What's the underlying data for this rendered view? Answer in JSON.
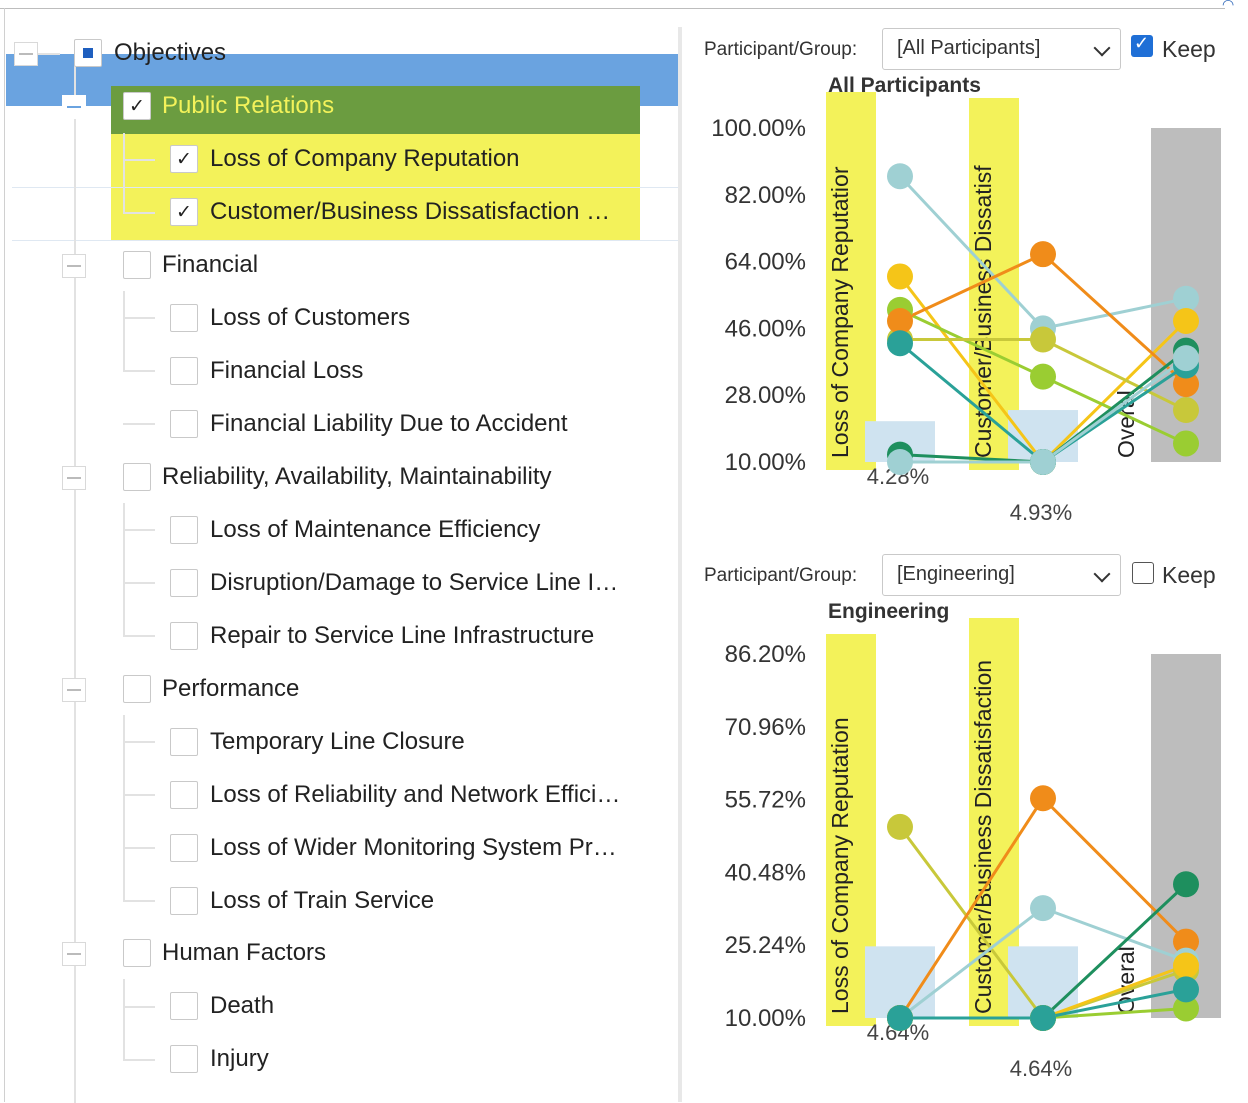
{
  "tree": {
    "root": {
      "label": "Objectives",
      "state": "partial"
    },
    "groups": [
      {
        "label": "Public Relations",
        "checked": true,
        "selected": true,
        "children": [
          {
            "label": "Loss of Company Reputation",
            "checked": true
          },
          {
            "label": "Customer/Business Dissatisfaction …",
            "checked": true
          }
        ]
      },
      {
        "label": "Financial",
        "checked": false,
        "children": [
          {
            "label": "Loss of Customers",
            "checked": false
          },
          {
            "label": "Financial Loss",
            "checked": false
          },
          {
            "label": "Financial Liability Due to Accident",
            "checked": false
          }
        ]
      },
      {
        "label": "Reliability, Availability, Maintainability",
        "checked": false,
        "children": [
          {
            "label": "Loss of Maintenance Efficiency",
            "checked": false
          },
          {
            "label": "Disruption/Damage to Service Line I…",
            "checked": false
          },
          {
            "label": "Repair to Service Line Infrastructure",
            "checked": false
          }
        ]
      },
      {
        "label": "Performance",
        "checked": false,
        "children": [
          {
            "label": "Temporary Line Closure",
            "checked": false
          },
          {
            "label": "Loss of Reliability and Network Effici…",
            "checked": false
          },
          {
            "label": "Loss of Wider Monitoring System Pr…",
            "checked": false
          },
          {
            "label": "Loss of Train Service",
            "checked": false
          }
        ]
      },
      {
        "label": "Human Factors",
        "checked": false,
        "children": [
          {
            "label": "Death",
            "checked": false
          },
          {
            "label": "Injury",
            "checked": false
          }
        ]
      }
    ]
  },
  "panels": [
    {
      "participant_label": "Participant/Group:",
      "selected": "[All Participants]",
      "keep_label": "Keep",
      "keep_checked": true,
      "title": "All Participants"
    },
    {
      "participant_label": "Participant/Group:",
      "selected": "[Engineering]",
      "keep_label": "Keep",
      "keep_checked": false,
      "title": "Engineering"
    }
  ],
  "colors": {
    "selection": "#6aa3e0",
    "highlight": "#f3f25a",
    "highlight_dark": "#6b9c40",
    "bar_light": "#cfe3f0",
    "bar_overall": "#bdbdbd",
    "keep_checked": "#1f6fd6"
  },
  "chart_data": [
    {
      "type": "line",
      "title": "All Participants",
      "yticks": [
        "100.00%",
        "82.00%",
        "64.00%",
        "46.00%",
        "28.00%",
        "10.00%"
      ],
      "ylim": [
        10,
        100
      ],
      "columns": [
        "Loss of Company Reputatior",
        "Customer/Business Dissatisf",
        "Overal"
      ],
      "bar_values": [
        21,
        24,
        100
      ],
      "bar_labels": [
        "4.28%",
        "4.93%",
        ""
      ],
      "series": [
        {
          "color": "#9fd0d3",
          "values": [
            87,
            46,
            54
          ]
        },
        {
          "color": "#f5c518",
          "values": [
            60,
            10,
            48
          ]
        },
        {
          "color": "#9acd32",
          "values": [
            51,
            33,
            15
          ]
        },
        {
          "color": "#c8c83a",
          "values": [
            43,
            43,
            24
          ]
        },
        {
          "color": "#f08c1a",
          "values": [
            48,
            66,
            31
          ]
        },
        {
          "color": "#2aa198",
          "values": [
            42,
            10,
            36
          ]
        },
        {
          "color": "#1e8f5e",
          "values": [
            12,
            10,
            40
          ]
        },
        {
          "color": "#9fd0d3",
          "values": [
            10,
            10,
            38
          ]
        }
      ]
    },
    {
      "type": "line",
      "title": "Engineering",
      "yticks": [
        "86.20%",
        "70.96%",
        "55.72%",
        "40.48%",
        "25.24%",
        "10.00%"
      ],
      "ylim": [
        10,
        86.2
      ],
      "columns": [
        "Loss of Company Reputation",
        "Customer/Business Dissatisfaction",
        "Overal"
      ],
      "bar_values": [
        25,
        25,
        86.2
      ],
      "bar_labels": [
        "4.64%",
        "4.64%",
        ""
      ],
      "series": [
        {
          "color": "#c8c83a",
          "values": [
            50,
            10,
            20
          ]
        },
        {
          "color": "#f08c1a",
          "values": [
            10,
            56,
            26
          ]
        },
        {
          "color": "#9fd0d3",
          "values": [
            10,
            33,
            22
          ]
        },
        {
          "color": "#1e8f5e",
          "values": [
            10,
            10,
            38
          ]
        },
        {
          "color": "#9acd32",
          "values": [
            10,
            10,
            12
          ]
        },
        {
          "color": "#f5c518",
          "values": [
            10,
            10,
            21
          ]
        },
        {
          "color": "#2aa198",
          "values": [
            10,
            10,
            16
          ]
        }
      ]
    }
  ]
}
